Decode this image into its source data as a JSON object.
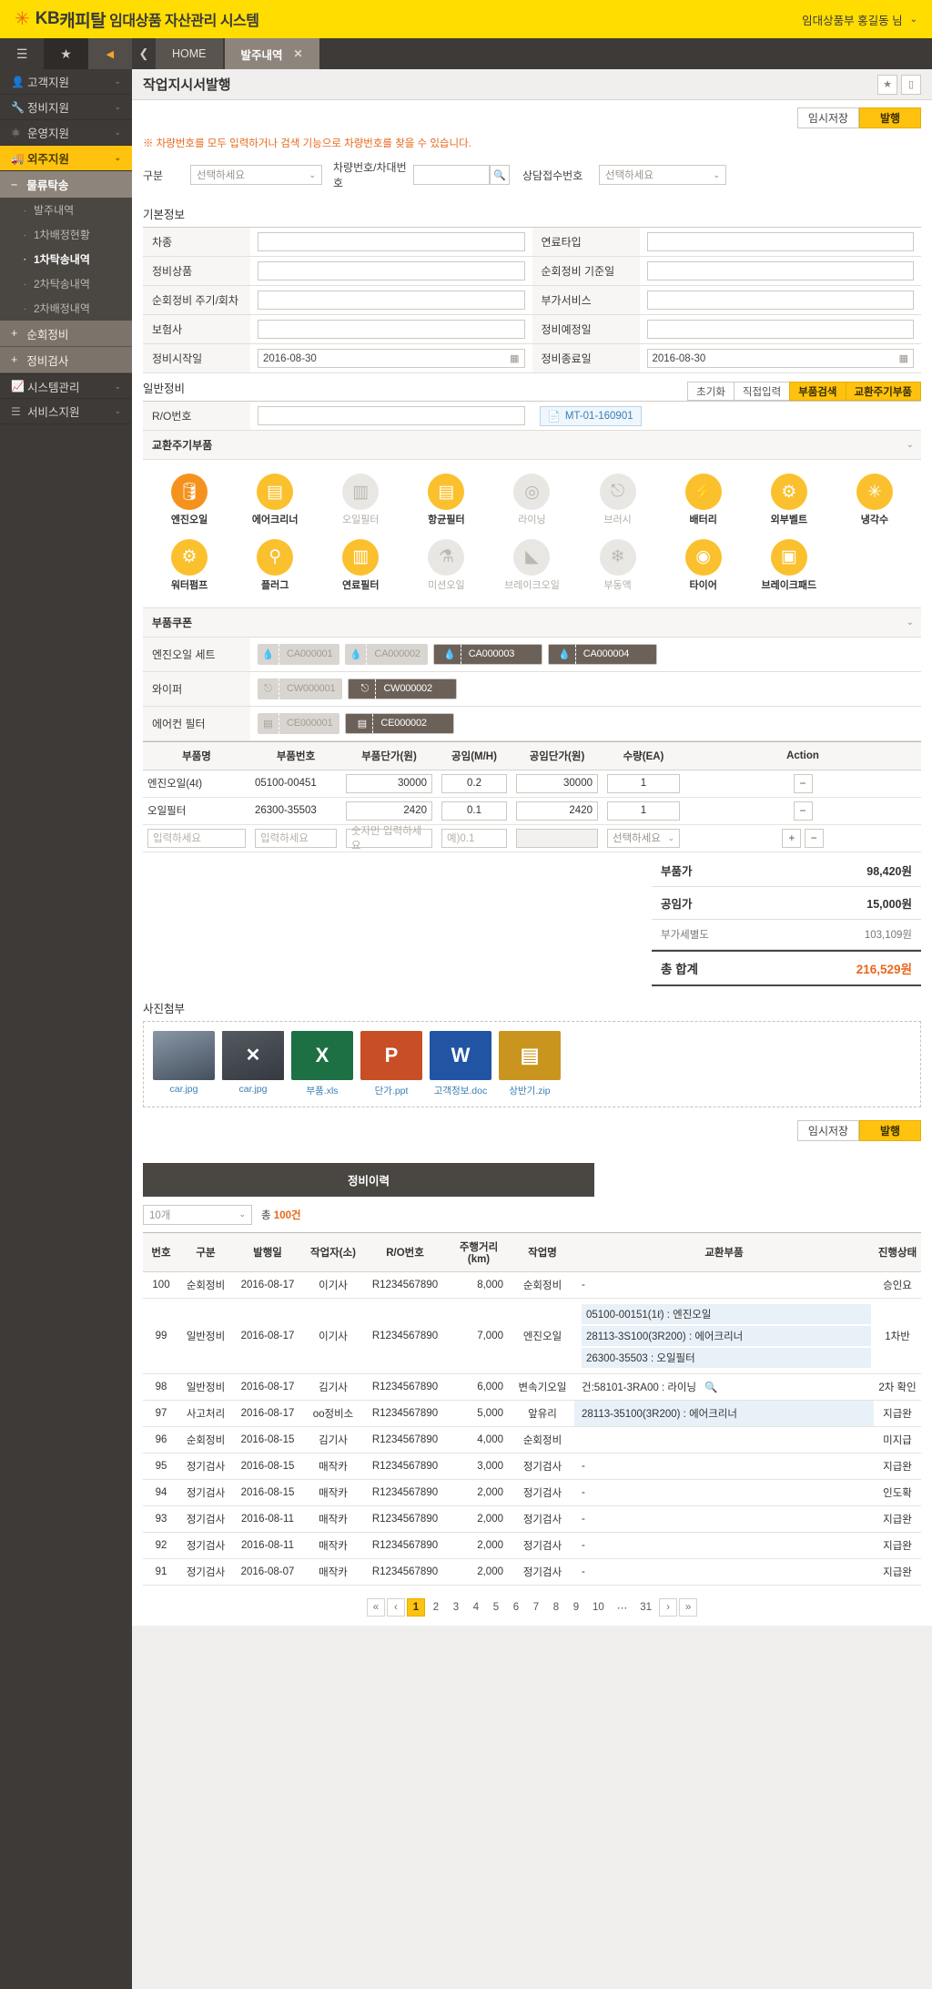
{
  "header": {
    "logo_kb": "KB",
    "logo_capital": "캐피탈",
    "logo_title": "임대상품 자산관리 시스템",
    "user": "임대상품부  홍길동 님",
    "user_caret": "⌄"
  },
  "tabs": {
    "menu_icon": "list-icon",
    "star_icon": "★",
    "collapse_icon": "◀",
    "back_icon": "❮",
    "items": [
      {
        "label": "HOME",
        "active": false,
        "closable": false
      },
      {
        "label": "발주내역",
        "active": true,
        "closable": true,
        "close": "✕"
      }
    ]
  },
  "sidebar": {
    "items": [
      {
        "label": "고객지원",
        "icon": "user-icon",
        "glyph": "👤",
        "type": "top",
        "caret": "⌄"
      },
      {
        "label": "정비지원",
        "icon": "wrench-icon",
        "glyph": "🔧",
        "type": "top",
        "caret": "⌄"
      },
      {
        "label": "운영지원",
        "icon": "sitemap-icon",
        "glyph": "⛯",
        "type": "top",
        "caret": "⌄"
      },
      {
        "label": "외주지원",
        "icon": "truck-icon",
        "glyph": "🚚",
        "type": "top",
        "active": true,
        "caret": "⌄"
      }
    ],
    "group": {
      "label": "물류탁송",
      "pm": "−"
    },
    "leaves": [
      {
        "label": "발주내역",
        "on": false
      },
      {
        "label": "1차배정현황",
        "on": false
      },
      {
        "label": "1차탁송내역",
        "on": true
      },
      {
        "label": "2차탁송내역",
        "on": false
      },
      {
        "label": "2차배정내역",
        "on": false
      }
    ],
    "collapsed": [
      {
        "label": "순회정비",
        "pm": "+"
      },
      {
        "label": "정비검사",
        "pm": "+"
      }
    ],
    "bottom": [
      {
        "label": "시스템관리",
        "icon": "chart-icon",
        "glyph": "📈",
        "caret": "⌄"
      },
      {
        "label": "서비스지원",
        "icon": "menu-icon",
        "glyph": "☰",
        "caret": "⌄"
      }
    ]
  },
  "page": {
    "title": "작업지시서발행",
    "star_icon": "★",
    "mobile_icon": "▯"
  },
  "actions": {
    "save_temp": "임시저장",
    "issue": "발행"
  },
  "notice": "※ 차량번호를 모두 입력하거나 검색 기능으로 차량번호를 찾을 수 있습니다.",
  "filter": {
    "gubun_label": "구분",
    "gubun_value": "선택하세요",
    "car_label": "차량번호/차대번호",
    "car_value": "",
    "search_icon": "🔍",
    "consult_label": "상담접수번호",
    "consult_value": "선택하세요",
    "caret": "⌄"
  },
  "basic": {
    "section": "기본정보",
    "rows": [
      {
        "l1": "차종",
        "v1": "",
        "l2": "연료타입",
        "v2": ""
      },
      {
        "l1": "정비상품",
        "v1": "",
        "l2": "순회정비 기준일",
        "v2": ""
      },
      {
        "l1": "순회정비 주기/회차",
        "v1": "",
        "l2": "부가서비스",
        "v2": ""
      },
      {
        "l1": "보험사",
        "v1": "",
        "l2": "정비예정일",
        "v2": ""
      },
      {
        "l1": "정비시작일",
        "v1": "2016-08-30",
        "cal1": true,
        "l2": "정비종료일",
        "v2": "2016-08-30",
        "cal2": true
      }
    ],
    "cal_icon": "▦"
  },
  "general": {
    "section": "일반정비",
    "subtabs": [
      {
        "label": "초기화",
        "on": false
      },
      {
        "label": "직접입력",
        "on": false
      },
      {
        "label": "부품검색",
        "on": true
      },
      {
        "label": "교환주기부품",
        "on": true
      }
    ],
    "ro_label": "R/O번호",
    "ro_value": "",
    "doc_icon": "📄",
    "doc_label": "MT-01-160901"
  },
  "cycle_parts": {
    "title": "교환주기부품",
    "collapse_icon": "⌄",
    "row1": [
      {
        "label": "엔진오일",
        "icon": "oil-can-icon",
        "glyph": "🛢",
        "state": "on1"
      },
      {
        "label": "에어크리너",
        "icon": "air-filter-icon",
        "glyph": "▤",
        "state": "on2"
      },
      {
        "label": "오일필터",
        "icon": "oil-filter-icon",
        "glyph": "▥",
        "state": "off"
      },
      {
        "label": "항균필터",
        "icon": "antibacterial-filter-icon",
        "glyph": "▤",
        "state": "on2"
      },
      {
        "label": "라이닝",
        "icon": "lining-icon",
        "glyph": "◎",
        "state": "off"
      },
      {
        "label": "브러시",
        "icon": "wiper-icon",
        "glyph": "⌁",
        "state": "off"
      },
      {
        "label": "배터리",
        "icon": "battery-icon",
        "glyph": "⚡",
        "state": "on2"
      },
      {
        "label": "외부벨트",
        "icon": "belt-icon",
        "glyph": "⚙",
        "state": "on2"
      },
      {
        "label": "냉각수",
        "icon": "coolant-icon",
        "glyph": "✳",
        "state": "on2"
      }
    ],
    "row2": [
      {
        "label": "워터펌프",
        "icon": "water-pump-icon",
        "glyph": "⚙",
        "state": "on2"
      },
      {
        "label": "플러그",
        "icon": "spark-plug-icon",
        "glyph": "⚲",
        "state": "on2"
      },
      {
        "label": "연료필터",
        "icon": "fuel-filter-icon",
        "glyph": "▥",
        "state": "on2"
      },
      {
        "label": "미션오일",
        "icon": "mission-oil-icon",
        "glyph": "⚗",
        "state": "off"
      },
      {
        "label": "브레이크오일",
        "icon": "brake-oil-icon",
        "glyph": "◣",
        "state": "off"
      },
      {
        "label": "부동액",
        "icon": "antifreeze-icon",
        "glyph": "❄",
        "state": "off"
      },
      {
        "label": "타이어",
        "icon": "tire-icon",
        "glyph": "◉",
        "state": "on2"
      },
      {
        "label": "브레이크패드",
        "icon": "brake-pad-icon",
        "glyph": "▣",
        "state": "on2"
      },
      {
        "label": "",
        "icon": "empty-icon",
        "glyph": "",
        "state": "none"
      }
    ]
  },
  "coupons": {
    "title": "부품쿠폰",
    "collapse_icon": "⌄",
    "rows": [
      {
        "label": "엔진오일 세트",
        "icon": "oil-drop-icon",
        "glyph": "💧",
        "chips": [
          {
            "code": "CA000001",
            "sel": false
          },
          {
            "code": "CA000002",
            "sel": false
          },
          {
            "code": "CA000003",
            "sel": true
          },
          {
            "code": "CA000004",
            "sel": true
          }
        ]
      },
      {
        "label": "와이퍼",
        "icon": "wiper-icon",
        "glyph": "⌁",
        "chips": [
          {
            "code": "CW000001",
            "sel": false
          },
          {
            "code": "CW000002",
            "sel": true
          }
        ]
      },
      {
        "label": "에어컨 필터",
        "icon": "ac-filter-icon",
        "glyph": "▤",
        "chips": [
          {
            "code": "CE000001",
            "sel": false
          },
          {
            "code": "CE000002",
            "sel": true
          }
        ]
      }
    ]
  },
  "parts_table": {
    "headers": [
      "부품명",
      "부품번호",
      "부품단가(원)",
      "공임(M/H)",
      "공임단가(원)",
      "수량(EA)",
      "Action"
    ],
    "rows": [
      {
        "name": "엔진오일(4ℓ)",
        "no": "05100-00451",
        "price": "30000",
        "mh": "0.2",
        "rate": "30000",
        "qty": "1",
        "action": "−"
      },
      {
        "name": "오일필터",
        "no": "26300-35503",
        "price": "2420",
        "mh": "0.1",
        "rate": "2420",
        "qty": "1",
        "action": "−"
      }
    ],
    "new_row": {
      "name_ph": "입력하세요",
      "no_ph": "입력하세요",
      "price_ph": "숫자만 입력하세요",
      "mh_ph": "예)0.1",
      "rate_ph": "",
      "qty_ph": "선택하세요",
      "qty_caret": "⌄",
      "add": "+",
      "del": "−"
    }
  },
  "totals": {
    "rows": [
      {
        "label": "부품가",
        "value": "98,420원",
        "style": "b"
      },
      {
        "label": "공임가",
        "value": "15,000원",
        "style": "b"
      },
      {
        "label": "부가세별도",
        "value": "103,109원",
        "style": "sm"
      },
      {
        "label": "총 합계",
        "value": "216,529원",
        "style": "grand"
      }
    ]
  },
  "attachments": {
    "section": "사진첨부",
    "files": [
      {
        "name": "car.jpg",
        "kind": "photo",
        "color": "#6b7a8f",
        "glyph": ""
      },
      {
        "name": "car.jpg",
        "kind": "photo-x",
        "color": "#6b7a8f",
        "glyph": "✕"
      },
      {
        "name": "부품.xls",
        "kind": "excel",
        "color": "#1d7044",
        "glyph": "X"
      },
      {
        "name": "단가.ppt",
        "kind": "ppt",
        "color": "#c74e25",
        "glyph": "P"
      },
      {
        "name": "고객정보.doc",
        "kind": "word",
        "color": "#2155a3",
        "glyph": "W"
      },
      {
        "name": "상반기.zip",
        "kind": "zip",
        "color": "#c9951f",
        "glyph": "▤"
      }
    ]
  },
  "actions_bottom": {
    "save_temp": "임시저장",
    "issue": "발행"
  },
  "history": {
    "title": "정비이력",
    "page_size": "10개",
    "page_size_caret": "⌄",
    "total_prefix": "총",
    "total_count": "100건",
    "headers": [
      "번호",
      "구분",
      "발행일",
      "작업자(소)",
      "R/O번호",
      "주행거리(km)",
      "작업명",
      "교환부품",
      "진행상태"
    ],
    "rows": [
      {
        "no": "100",
        "gubun": "순회정비",
        "date": "2016-08-17",
        "worker": "이기사",
        "ro": "R1234567890",
        "km": "8,000",
        "job": "순회정비",
        "parts": [
          "-"
        ],
        "status": "승인요"
      },
      {
        "no": "99",
        "gubun": "일반정비",
        "date": "2016-08-17",
        "worker": "이기사",
        "ro": "R1234567890",
        "km": "7,000",
        "job": "엔진오일",
        "parts": [
          "05100-00151(1ℓ) : 엔진오일",
          "28113-3S100(3R200) : 에어크리너",
          "26300-35503 : 오일필터"
        ],
        "parts_hl": true,
        "status": "1차반"
      },
      {
        "no": "98",
        "gubun": "일반정비",
        "date": "2016-08-17",
        "worker": "김기사",
        "ro": "R1234567890",
        "km": "6,000",
        "job": "변속기오일",
        "parts": [
          "건:58101-3RA00 : 라이닝"
        ],
        "parts_icon": "🔍",
        "status": "2차 확인"
      },
      {
        "no": "97",
        "gubun": "사고처리",
        "date": "2016-08-17",
        "worker": "oo정비소",
        "ro": "R1234567890",
        "km": "5,000",
        "job": "앞유리",
        "parts": [
          "28113-35100(3R200) : 에어크리너"
        ],
        "parts_hl": true,
        "status": "지급완"
      },
      {
        "no": "96",
        "gubun": "순회정비",
        "date": "2016-08-15",
        "worker": "김기사",
        "ro": "R1234567890",
        "km": "4,000",
        "job": "순회정비",
        "parts": [
          ""
        ],
        "status": "미지급"
      },
      {
        "no": "95",
        "gubun": "정기검사",
        "date": "2016-08-15",
        "worker": "매작카",
        "ro": "R1234567890",
        "km": "3,000",
        "job": "정기검사",
        "parts": [
          "-"
        ],
        "status": "지급완"
      },
      {
        "no": "94",
        "gubun": "정기검사",
        "date": "2016-08-15",
        "worker": "매작카",
        "ro": "R1234567890",
        "km": "2,000",
        "job": "정기검사",
        "parts": [
          "-"
        ],
        "status": "인도확"
      },
      {
        "no": "93",
        "gubun": "정기검사",
        "date": "2016-08-11",
        "worker": "매작카",
        "ro": "R1234567890",
        "km": "2,000",
        "job": "정기검사",
        "parts": [
          "-"
        ],
        "status": "지급완"
      },
      {
        "no": "92",
        "gubun": "정기검사",
        "date": "2016-08-11",
        "worker": "매작카",
        "ro": "R1234567890",
        "km": "2,000",
        "job": "정기검사",
        "parts": [
          "-"
        ],
        "status": "지급완"
      },
      {
        "no": "91",
        "gubun": "정기검사",
        "date": "2016-08-07",
        "worker": "매작카",
        "ro": "R1234567890",
        "km": "2,000",
        "job": "정기검사",
        "parts": [
          "-"
        ],
        "status": "지급완"
      }
    ],
    "pager": {
      "first": "«",
      "prev": "‹",
      "pages": [
        "1",
        "2",
        "3",
        "4",
        "5",
        "6",
        "7",
        "8",
        "9",
        "10"
      ],
      "ellipsis": "⋯",
      "last_page": "31",
      "next": "›",
      "end": "»",
      "current": "1"
    }
  }
}
